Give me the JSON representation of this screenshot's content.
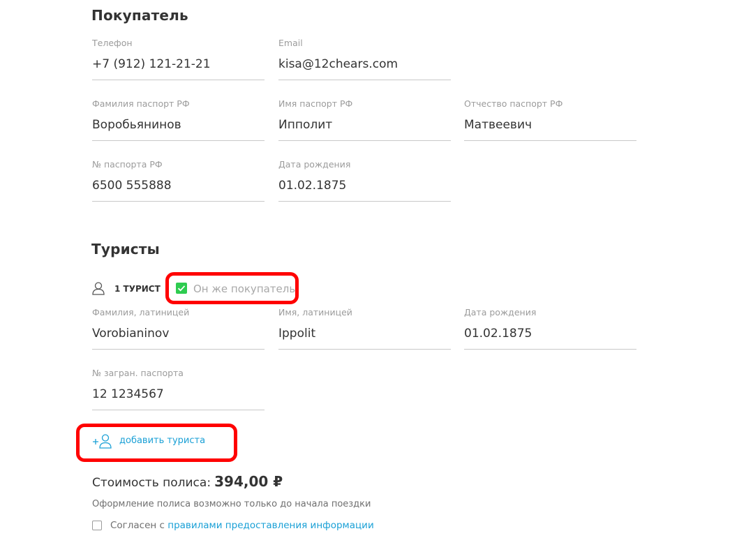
{
  "buyer": {
    "title": "Покупатель",
    "phone": {
      "label": "Телефон",
      "value": "+7 (912) 121-21-21"
    },
    "email": {
      "label": "Email",
      "value": "kisa@12chears.com"
    },
    "surname": {
      "label": "Фамилия паспорт РФ",
      "value": "Воробьянинов"
    },
    "name": {
      "label": "Имя паспорт РФ",
      "value": "Ипполит"
    },
    "patronymic": {
      "label": "Отчество паспорт РФ",
      "value": "Матвеевич"
    },
    "passport": {
      "label": "№ паспорта РФ",
      "value": "6500 555888"
    },
    "birth": {
      "label": "Дата рождения",
      "value": "01.02.1875"
    }
  },
  "tourists": {
    "title": "Туристы",
    "tourist_label": "1 ТУРИСТ",
    "same_as_buyer": {
      "label": "Он же покупатель",
      "checked": true,
      "color": "#2ecc50"
    },
    "surname_lat": {
      "label": "Фамилия, латиницей",
      "value": "Vorobianinov"
    },
    "name_lat": {
      "label": "Имя, латиницей",
      "value": "Ippolit"
    },
    "birth": {
      "label": "Дата рождения",
      "value": "01.02.1875"
    },
    "foreign_passport": {
      "label": "№ загран. паспорта",
      "value": "12 1234567"
    },
    "add_tourist": "добавить туриста"
  },
  "policy": {
    "cost_label": "Стоимость полиса:",
    "cost_value": "394,00 ₽",
    "note": "Оформление полиса возможно только до начала поездки",
    "agree_prefix": "Согласен с",
    "agree_link": "правилами предоставления информации"
  },
  "colors": {
    "accent": "#1aa0d6",
    "highlight": "#ff0000",
    "check": "#2ecc50"
  },
  "icons": {
    "user": "user-icon",
    "add_user": "add-user-icon",
    "check": "check-icon"
  }
}
